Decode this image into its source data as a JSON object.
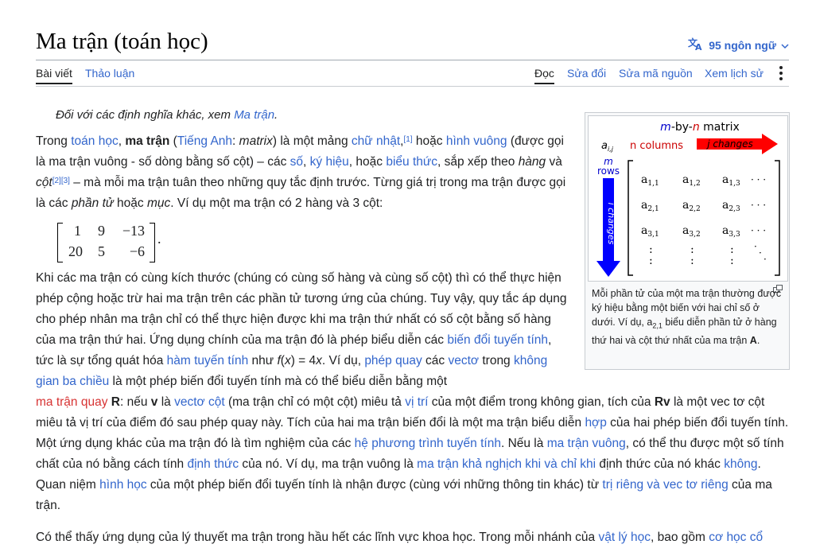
{
  "page": {
    "title": "Ma trận (toán học)",
    "languages": "95 ngôn ngữ"
  },
  "tabs": {
    "article": "Bài viết",
    "talk": "Thảo luận",
    "read": "Đọc",
    "edit": "Sửa đổi",
    "edit_source": "Sửa mã nguồn",
    "history": "Xem lịch sử"
  },
  "hatnote": {
    "prefix": "Đối với các định nghĩa khác, xem ",
    "link": "Ma trận",
    "suffix": "."
  },
  "matrix": {
    "cells": [
      [
        "1",
        "9",
        "−13"
      ],
      [
        "20",
        "5",
        "−6"
      ]
    ],
    "trailing": "."
  },
  "figure": {
    "title_m": "m",
    "title_rest": "-by-",
    "title_n": "n",
    "title_end": " matrix",
    "aij": "a",
    "aij_sub": "i,j",
    "ncols": "n columns",
    "jchanges": "j changes",
    "m": "m",
    "rows": "rows",
    "ichanges": "i changes",
    "entries": [
      [
        "a",
        "1,1"
      ],
      [
        "a",
        "1,2"
      ],
      [
        "a",
        "1,3"
      ],
      [
        "a",
        "2,1"
      ],
      [
        "a",
        "2,2"
      ],
      [
        "a",
        "2,3"
      ],
      [
        "a",
        "3,1"
      ],
      [
        "a",
        "3,2"
      ],
      [
        "a",
        "3,3"
      ]
    ],
    "dots": "· · ·",
    "vdots": ":"
  },
  "caption": {
    "text1": "Mỗi phần tử của một ma trận thường được ký hiệu bằng một biến với hai chỉ số ở dưới. Ví dụ, a",
    "sub": "2,1",
    "text2": " biểu diễn phần tử ở hàng thứ hai và cột thứ nhất của ma trận ",
    "bold": "A",
    "end": "."
  },
  "colors": {
    "link": "#3366cc",
    "redlink": "#d73333",
    "arrow_red": "#ff0000",
    "arrow_blue": "#0000ff"
  }
}
